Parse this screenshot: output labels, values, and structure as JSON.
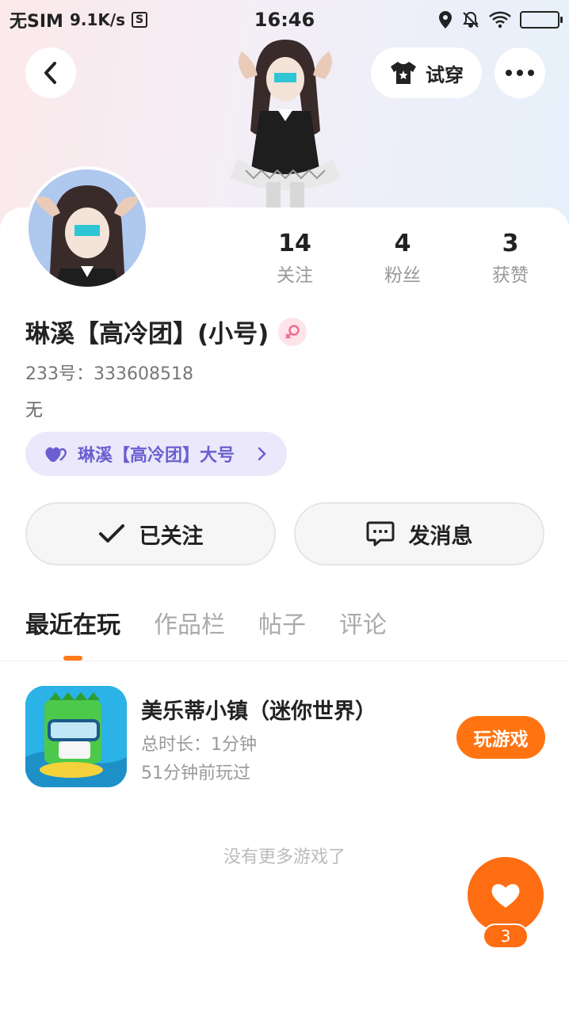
{
  "status_bar": {
    "carrier": "无SIM",
    "speed": "9.1K/s",
    "s_icon_label": "S",
    "time": "16:46"
  },
  "header": {
    "try_on_label": "试穿"
  },
  "stats": [
    {
      "value": "14",
      "label": "关注"
    },
    {
      "value": "4",
      "label": "粉丝"
    },
    {
      "value": "3",
      "label": "获赞"
    }
  ],
  "profile": {
    "username": "琳溪【高冷团】(小号)",
    "uid": "233号：333608518",
    "bio": "无",
    "linked_account": "琳溪【高冷团】大号",
    "gender": "female"
  },
  "actions": {
    "follow_label": "已关注",
    "message_label": "发消息"
  },
  "tabs": [
    "最近在玩",
    "作品栏",
    "帖子",
    "评论"
  ],
  "active_tab": 0,
  "games": [
    {
      "title": "美乐蒂小镇（迷你世界）",
      "total_time": "总时长：1分钟",
      "last_played": "51分钟前玩过",
      "play_label": "玩游戏"
    }
  ],
  "no_more_text": "没有更多游戏了",
  "fab": {
    "count": "3"
  },
  "colors": {
    "accent": "#ff7411",
    "linked_pill_bg": "#ebe8fb",
    "linked_pill_text": "#6b5fd0"
  }
}
